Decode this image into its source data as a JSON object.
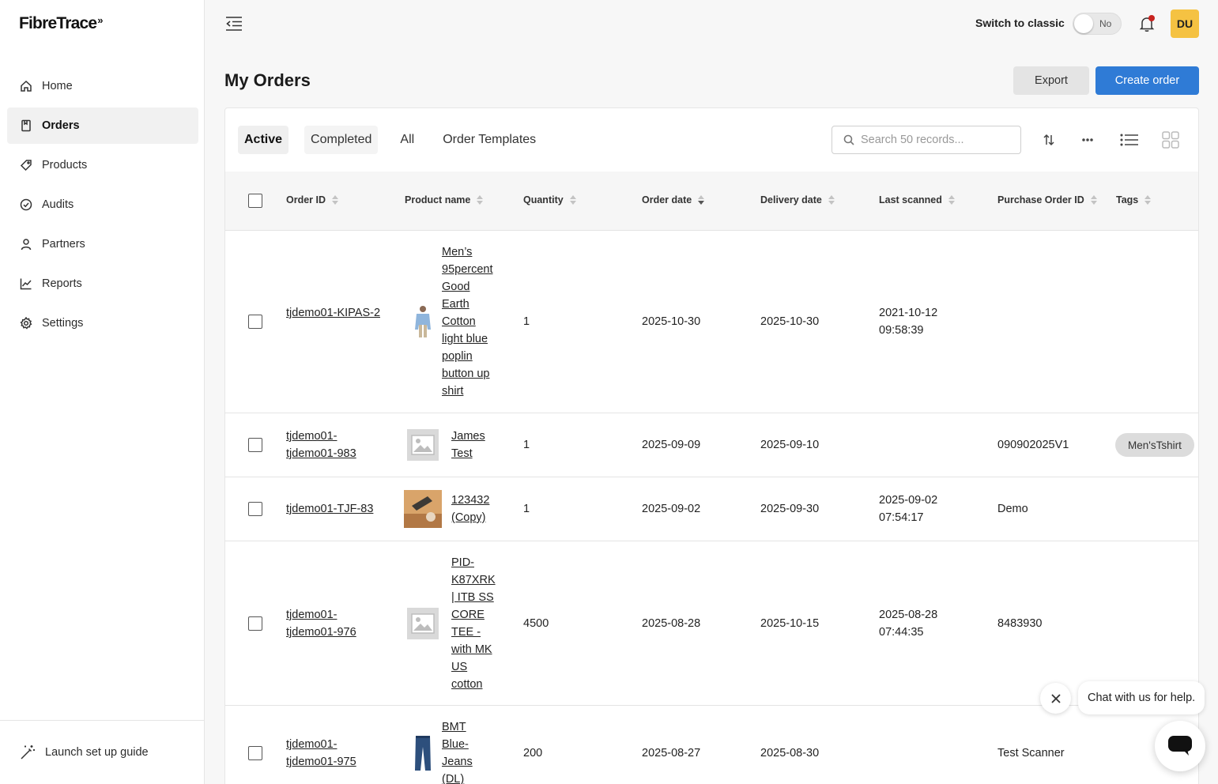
{
  "app": {
    "logo_text": "FibreTrace",
    "logo_mark": "»"
  },
  "sidebar": {
    "items": [
      {
        "label": "Home",
        "icon": "home-icon"
      },
      {
        "label": "Orders",
        "icon": "orders-icon",
        "active": true
      },
      {
        "label": "Products",
        "icon": "tag-icon"
      },
      {
        "label": "Audits",
        "icon": "check-circle-icon"
      },
      {
        "label": "Partners",
        "icon": "person-icon"
      },
      {
        "label": "Reports",
        "icon": "chart-icon"
      },
      {
        "label": "Settings",
        "icon": "gear-icon"
      }
    ],
    "footer_label": "Launch set up guide"
  },
  "header": {
    "switch_label": "Switch to classic",
    "toggle_value": "No",
    "avatar_initials": "DU"
  },
  "page": {
    "title": "My Orders",
    "export_label": "Export",
    "create_label": "Create order"
  },
  "tabs": [
    "Active",
    "Completed",
    "All",
    "Order Templates"
  ],
  "search": {
    "placeholder": "Search 50 records..."
  },
  "table": {
    "columns": [
      "Order ID",
      "Product name",
      "Quantity",
      "Order date",
      "Delivery date",
      "Last scanned",
      "Purchase Order ID",
      "Tags"
    ],
    "rows": [
      {
        "order_id": "tjdemo01-KIPAS-2",
        "product": "Men’s 95percent Good Earth Cotton light blue poplin button up shirt",
        "quantity": "1",
        "order_date": "2025-10-30",
        "delivery_date": "2025-10-30",
        "last_scanned": "2021-10-12 09:58:39",
        "po_id": "",
        "tag": ""
      },
      {
        "order_id": "tjdemo01-tjdemo01-983",
        "product": "James Test",
        "quantity": "1",
        "order_date": "2025-09-09",
        "delivery_date": "2025-09-10",
        "last_scanned": "",
        "po_id": "090902025V1",
        "tag": "Men'sTshirt"
      },
      {
        "order_id": "tjdemo01-TJF-83",
        "product": "123432 (Copy)",
        "quantity": "1",
        "order_date": "2025-09-02",
        "delivery_date": "2025-09-30",
        "last_scanned": "2025-09-02 07:54:17",
        "po_id": "Demo",
        "tag": ""
      },
      {
        "order_id": "tjdemo01-tjdemo01-976",
        "product": "PID-K87XRK | ITB SS CORE TEE - with MK US cotton",
        "quantity": "4500",
        "order_date": "2025-08-28",
        "delivery_date": "2025-10-15",
        "last_scanned": "2025-08-28 07:44:35",
        "po_id": "8483930",
        "tag": ""
      },
      {
        "order_id": "tjdemo01-tjdemo01-975",
        "product": "BMT Blue-Jeans (DL)",
        "quantity": "200",
        "order_date": "2025-08-27",
        "delivery_date": "2025-08-30",
        "last_scanned": "",
        "po_id": "Test Scanner",
        "tag": ""
      }
    ]
  },
  "chat": {
    "message": "Chat with us for help."
  },
  "colors": {
    "primary": "#2f7bd6",
    "avatar": "#f5c242",
    "notification_dot": "#c8231f"
  }
}
